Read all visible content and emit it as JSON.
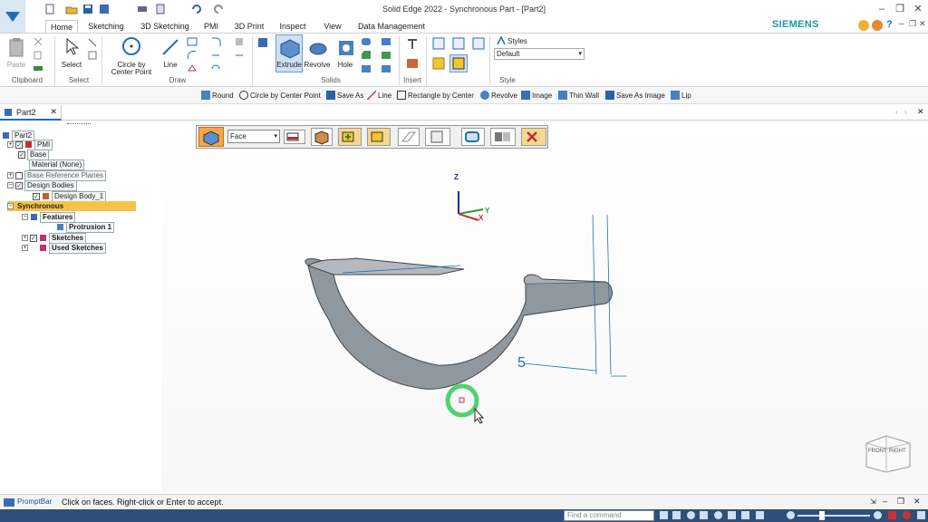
{
  "window": {
    "title": "Solid Edge 2022 - Synchronous Part - [Part2]",
    "brand": "SIEMENS"
  },
  "tabs": [
    "Home",
    "Sketching",
    "3D Sketching",
    "PMI",
    "3D Print",
    "Inspect",
    "View",
    "Data Management"
  ],
  "active_tab": "Home",
  "ribbon": {
    "clipboard": {
      "paste": "Paste",
      "group": "Clipboard"
    },
    "select": {
      "select": "Select",
      "group": "Select"
    },
    "draw": {
      "circle1": "Circle by",
      "circle2": "Center Point",
      "line": "Line",
      "group": "Draw"
    },
    "solids": {
      "extrude": "Extrude",
      "revolve": "Revolve",
      "hole": "Hole",
      "group": "Solids"
    },
    "insert": {
      "group": "Insert"
    },
    "style": {
      "styles": "Styles",
      "value": "Default",
      "group": "Style"
    }
  },
  "command_bar": [
    "Round",
    "Circle by Center Point",
    "Save As",
    "Line",
    "Rectangle by Center",
    "Revolve",
    "Image",
    "Thin Wall",
    "Save As Image",
    "Lip"
  ],
  "document_tab": "Part2",
  "tree": {
    "root": "Part2",
    "pmi": "PMI",
    "base": "Base",
    "material": "Material (None)",
    "ref_planes": "Base Reference Planes",
    "design_bodies": "Design Bodies",
    "design_body": "Design Body_1",
    "synchronous": "Synchronous",
    "features": "Features",
    "protrusion": "Protrusion 1",
    "sketches": "Sketches",
    "used_sketches": "Used Sketches"
  },
  "quickbar": {
    "select_value": "Face"
  },
  "viewport": {
    "dimension": "5",
    "axis_z": "Z",
    "axis_y": "Y",
    "axis_x": "X",
    "cube_front": "FRONT",
    "cube_right": "RIGHT"
  },
  "status": {
    "promptbar": "PromptBar",
    "message": "Click on faces.  Right-click or Enter to accept.",
    "find_placeholder": "Find a command"
  }
}
